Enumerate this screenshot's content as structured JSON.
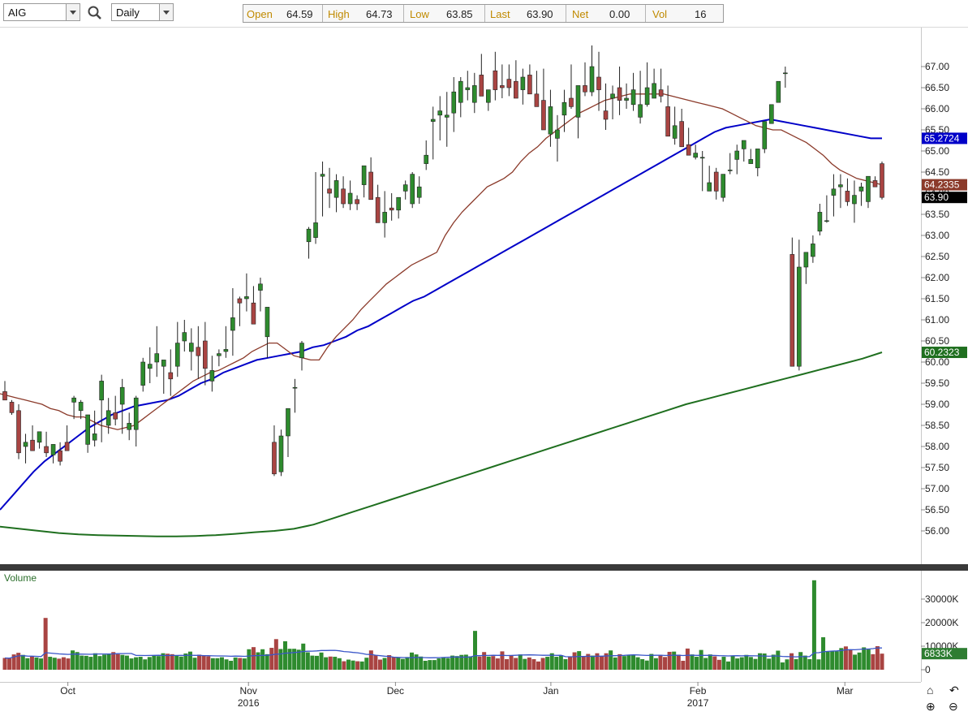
{
  "toolbar": {
    "symbol": "AIG",
    "period": "Daily",
    "open_label": "Open",
    "open": "64.59",
    "high_label": "High",
    "high": "64.73",
    "low_label": "Low",
    "low": "63.85",
    "last_label": "Last",
    "last": "63.90",
    "net_label": "Net",
    "net": "0.00",
    "vol_label": "Vol",
    "vol": "16"
  },
  "volume_panel": {
    "title": "Volume"
  },
  "colors": {
    "up": "#2e8b2e",
    "down": "#a94442",
    "ma20": "#8b3a2a",
    "ma50": "#0000c8",
    "ma200": "#1f6f1f",
    "last_tag": "#000000",
    "volume_ma": "#3a56c8"
  },
  "chart_data": [
    {
      "type": "candlestick",
      "panel": "price",
      "y_ticks": [
        "67.00",
        "66.50",
        "66.00",
        "65.50",
        "65.00",
        "64.50",
        "64.00",
        "63.50",
        "63.00",
        "62.50",
        "62.00",
        "61.50",
        "61.00",
        "60.50",
        "60.00",
        "59.50",
        "59.00",
        "58.50",
        "58.00",
        "57.50",
        "57.00",
        "56.50",
        "56.00"
      ],
      "ylim": [
        55.3,
        67.9
      ],
      "x_labels": [
        "Oct",
        "Nov",
        "Dec",
        "Jan",
        "Feb",
        "Mar"
      ],
      "x_sublabels": [
        "2016",
        "2017"
      ],
      "series": [
        {
          "name": "OHLC",
          "o": [
            59.3,
            59.05,
            58.85,
            58.0,
            58.15,
            58.1,
            58.0,
            57.8,
            57.9,
            58.1,
            59.05,
            58.85,
            58.05,
            58.15,
            59.1,
            58.5,
            58.8,
            59.0,
            58.4,
            58.4,
            59.45,
            59.85,
            60.0,
            59.9,
            59.75,
            59.9,
            60.5,
            60.25,
            60.35,
            60.5,
            59.55,
            60.15,
            60.25,
            60.75,
            61.5,
            61.5,
            61.4,
            61.7,
            60.6,
            58.1,
            57.4,
            58.25,
            59.4,
            60.1,
            62.85,
            62.95,
            64.4,
            64.1,
            63.9,
            64.1,
            63.75,
            63.85,
            64.2,
            64.5,
            63.9,
            63.3,
            63.65,
            63.6,
            64.05,
            63.75,
            63.9,
            64.7,
            65.7,
            65.85,
            65.8,
            65.9,
            66.15,
            66.45,
            66.15,
            66.8,
            66.15,
            66.9,
            66.55,
            66.7,
            66.65,
            66.45,
            66.8,
            66.35,
            66.2,
            65.4,
            65.3,
            65.85,
            66.25,
            65.8,
            66.55,
            66.4,
            66.75,
            65.95,
            66.25,
            66.5,
            66.2,
            66.1,
            65.8,
            66.1,
            66.25,
            66.45,
            66.05,
            65.3,
            65.7,
            65.15,
            64.85,
            64.85,
            64.05,
            64.5,
            63.9,
            64.55,
            64.8,
            65.05,
            64.7,
            64.6,
            65.05,
            65.65,
            66.15,
            66.85,
            62.55,
            59.9,
            62.25,
            62.5,
            63.1,
            63.35,
            63.95,
            64.15,
            64.05,
            63.75,
            64.05,
            63.8,
            64.3,
            64.7
          ],
          "h": [
            59.55,
            59.1,
            59.0,
            58.3,
            58.5,
            58.25,
            58.35,
            58.05,
            58.1,
            58.5,
            59.2,
            59.1,
            58.6,
            58.85,
            59.7,
            59.15,
            59.2,
            59.6,
            58.8,
            59.2,
            60.1,
            60.35,
            60.85,
            60.05,
            60.3,
            60.95,
            61.0,
            60.8,
            60.85,
            60.95,
            60.15,
            60.3,
            60.85,
            61.75,
            61.55,
            62.1,
            61.8,
            62.0,
            61.3,
            58.5,
            58.4,
            58.75,
            59.6,
            60.5,
            63.2,
            64.5,
            64.75,
            64.6,
            64.45,
            64.4,
            64.3,
            63.95,
            64.65,
            64.85,
            64.2,
            64.05,
            64.0,
            63.9,
            64.3,
            64.5,
            64.4,
            65.25,
            66.05,
            66.3,
            66.4,
            66.75,
            66.75,
            66.9,
            66.85,
            67.3,
            66.35,
            67.35,
            67.05,
            67.05,
            67.15,
            66.95,
            67.05,
            66.9,
            66.95,
            66.45,
            65.85,
            66.45,
            67.05,
            66.35,
            67.1,
            67.5,
            67.35,
            66.6,
            66.55,
            67.0,
            66.6,
            66.85,
            66.9,
            67.1,
            66.95,
            66.95,
            66.55,
            66.05,
            66.0,
            65.55,
            65.15,
            65.0,
            64.65,
            64.6,
            64.1,
            64.95,
            65.15,
            65.25,
            65.05,
            65.0,
            65.45,
            66.05,
            66.25,
            67.0,
            62.95,
            62.9,
            62.55,
            63.0,
            63.75,
            63.95,
            64.45,
            64.45,
            64.35,
            64.3,
            64.25,
            64.35,
            64.4,
            64.75
          ],
          "l": [
            59.1,
            58.75,
            57.7,
            57.6,
            57.9,
            57.95,
            57.75,
            57.6,
            57.55,
            57.9,
            58.65,
            58.65,
            57.85,
            58.0,
            58.1,
            58.3,
            58.5,
            58.3,
            58.15,
            58.0,
            59.3,
            59.5,
            59.65,
            59.25,
            59.2,
            59.65,
            60.25,
            59.8,
            59.6,
            59.45,
            59.3,
            59.9,
            60.1,
            60.15,
            60.85,
            61.2,
            61.0,
            61.2,
            60.1,
            57.3,
            57.3,
            57.75,
            58.8,
            59.8,
            62.45,
            62.8,
            63.45,
            63.65,
            63.55,
            63.65,
            63.6,
            63.6,
            63.9,
            63.85,
            63.5,
            62.95,
            63.35,
            63.4,
            63.85,
            63.65,
            63.75,
            64.55,
            64.8,
            65.25,
            65.1,
            65.45,
            65.8,
            66.2,
            65.9,
            66.45,
            65.95,
            66.2,
            66.25,
            66.3,
            66.35,
            66.1,
            66.5,
            66.15,
            66.0,
            65.1,
            64.75,
            65.45,
            66.0,
            65.3,
            66.3,
            66.3,
            65.95,
            65.5,
            65.75,
            65.85,
            66.0,
            65.95,
            65.65,
            66.05,
            66.25,
            66.15,
            65.35,
            65.15,
            65.15,
            64.9,
            64.8,
            64.05,
            64.05,
            63.85,
            63.8,
            64.45,
            64.45,
            64.75,
            64.7,
            64.4,
            64.95,
            65.65,
            66.15,
            66.5,
            60.4,
            59.8,
            61.85,
            62.35,
            63.0,
            63.3,
            63.45,
            63.65,
            63.7,
            63.3,
            63.7,
            63.65,
            64.2,
            63.85
          ],
          "c": [
            59.1,
            58.8,
            57.85,
            58.1,
            57.9,
            58.35,
            57.85,
            58.05,
            57.65,
            57.9,
            59.15,
            59.05,
            58.75,
            58.3,
            59.55,
            58.85,
            58.65,
            59.4,
            58.55,
            59.15,
            60.0,
            59.95,
            60.2,
            60.05,
            59.6,
            60.45,
            60.7,
            60.45,
            60.15,
            59.85,
            59.8,
            60.2,
            60.3,
            61.05,
            61.4,
            61.55,
            60.9,
            61.85,
            61.3,
            57.35,
            58.25,
            58.9,
            59.4,
            60.45,
            63.15,
            63.3,
            64.45,
            64.0,
            64.3,
            63.75,
            64.0,
            63.75,
            64.65,
            63.85,
            63.3,
            63.55,
            63.6,
            63.9,
            64.2,
            64.45,
            64.15,
            64.9,
            65.75,
            65.95,
            65.85,
            66.4,
            66.65,
            66.5,
            66.55,
            66.3,
            66.45,
            66.45,
            66.5,
            66.5,
            66.25,
            66.75,
            66.35,
            66.05,
            65.5,
            66.05,
            65.5,
            66.15,
            66.05,
            66.55,
            66.4,
            67.0,
            66.45,
            65.75,
            66.35,
            66.2,
            66.25,
            66.45,
            66.1,
            66.5,
            66.6,
            66.3,
            65.35,
            65.6,
            65.1,
            64.9,
            64.95,
            64.85,
            64.25,
            64.05,
            64.45,
            64.55,
            65.0,
            65.25,
            64.8,
            65.05,
            65.7,
            66.1,
            66.65,
            66.85,
            59.9,
            62.25,
            62.6,
            62.8,
            63.55,
            63.35,
            64.1,
            64.2,
            63.8,
            63.95,
            64.15,
            64.4,
            64.15,
            63.9
          ]
        },
        {
          "name": "MA20",
          "values": [
            59.25,
            59.2,
            59.15,
            59.1,
            59.05,
            59.0,
            58.9,
            58.85,
            58.75,
            58.7,
            58.7,
            58.6,
            58.5,
            58.45,
            58.4,
            58.45,
            58.5,
            58.65,
            58.8,
            58.95,
            59.1,
            59.25,
            59.4,
            59.55,
            59.65,
            59.75,
            59.8,
            59.9,
            60.0,
            60.1,
            60.25,
            60.35,
            60.45,
            60.45,
            60.3,
            60.15,
            60.1,
            60.05,
            60.05,
            60.35,
            60.6,
            60.8,
            61.0,
            61.25,
            61.45,
            61.65,
            61.85,
            62.0,
            62.15,
            62.3,
            62.4,
            62.5,
            62.6,
            63.0,
            63.3,
            63.55,
            63.75,
            63.95,
            64.15,
            64.25,
            64.35,
            64.5,
            64.75,
            64.95,
            65.1,
            65.3,
            65.45,
            65.6,
            65.75,
            65.9,
            66.0,
            66.1,
            66.2,
            66.25,
            66.3,
            66.35,
            66.35,
            66.35,
            66.35,
            66.35,
            66.3,
            66.25,
            66.2,
            66.15,
            66.1,
            66.05,
            66.0,
            65.9,
            65.8,
            65.7,
            65.6,
            65.55,
            65.5,
            65.5,
            65.4,
            65.3,
            65.2,
            65.05,
            64.9,
            64.7,
            64.55,
            64.45,
            64.35,
            64.3,
            64.25,
            64.2
          ]
        },
        {
          "name": "MA50",
          "values": [
            56.5,
            56.8,
            57.1,
            57.4,
            57.65,
            57.85,
            58.05,
            58.25,
            58.45,
            58.6,
            58.75,
            58.85,
            58.95,
            59.0,
            59.05,
            59.1,
            59.2,
            59.35,
            59.5,
            59.6,
            59.75,
            59.85,
            59.95,
            60.05,
            60.1,
            60.15,
            60.2,
            60.25,
            60.35,
            60.4,
            60.5,
            60.6,
            60.75,
            60.85,
            61.0,
            61.15,
            61.3,
            61.45,
            61.55,
            61.7,
            61.85,
            62.0,
            62.15,
            62.3,
            62.45,
            62.6,
            62.75,
            62.9,
            63.05,
            63.2,
            63.35,
            63.5,
            63.65,
            63.8,
            63.95,
            64.1,
            64.25,
            64.4,
            64.55,
            64.7,
            64.85,
            65.0,
            65.15,
            65.3,
            65.45,
            65.55,
            65.6,
            65.65,
            65.7,
            65.75,
            65.7,
            65.65,
            65.6,
            65.55,
            65.5,
            65.45,
            65.4,
            65.35,
            65.3,
            65.3
          ]
        },
        {
          "name": "MA200",
          "values": [
            56.1,
            56.05,
            56.0,
            55.95,
            55.92,
            55.9,
            55.89,
            55.88,
            55.87,
            55.87,
            55.88,
            55.9,
            55.93,
            55.97,
            56.0,
            56.05,
            56.15,
            56.3,
            56.45,
            56.6,
            56.75,
            56.9,
            57.05,
            57.2,
            57.35,
            57.5,
            57.65,
            57.8,
            57.95,
            58.1,
            58.25,
            58.4,
            58.55,
            58.7,
            58.85,
            59.0,
            59.12,
            59.24,
            59.36,
            59.48,
            59.6,
            59.72,
            59.84,
            59.96,
            60.08,
            60.23
          ]
        }
      ],
      "value_tags": [
        {
          "label": "65.2724",
          "series": "MA50"
        },
        {
          "label": "64.2335",
          "series": "MA20"
        },
        {
          "label": "63.90",
          "series": "Last"
        },
        {
          "label": "60.2323",
          "series": "MA200"
        }
      ],
      "grid": false
    },
    {
      "type": "bar",
      "panel": "volume",
      "title": "Volume",
      "y_ticks": [
        "30000K",
        "20000K",
        "10000K",
        "0"
      ],
      "ylim": [
        0,
        40000
      ],
      "current_label": "6833K",
      "values": [
        5000,
        4800,
        6500,
        7200,
        6300,
        4900,
        5600,
        5200,
        4800,
        22000,
        5500,
        5100,
        4700,
        5300,
        4800,
        8200,
        7500,
        6000,
        5900,
        5500,
        7000,
        5800,
        6400,
        6900,
        7500,
        6600,
        6300,
        6000,
        4800,
        5300,
        5500,
        4400,
        5400,
        6100,
        5800,
        7000,
        6800,
        6600,
        6000,
        5600,
        6900,
        7700,
        5100,
        6400,
        6000,
        5700,
        4900,
        4900,
        5300,
        4400,
        3800,
        5200,
        5000,
        4800,
        8700,
        9600,
        7400,
        8700,
        6600,
        9300,
        13000,
        8800,
        12100,
        8900,
        8900,
        8500,
        11100,
        7400,
        6000,
        5900,
        7300,
        5300,
        5600,
        5500,
        4900,
        3600,
        4300,
        3900,
        3600,
        3500,
        5100,
        8200,
        6100,
        4300,
        5000,
        6200,
        5400,
        5200,
        4600,
        5400,
        7300,
        6500,
        5600,
        3800,
        4100,
        4100,
        4800,
        5200,
        4900,
        6000,
        5800,
        6300,
        6400,
        5700,
        16500,
        5600,
        7500,
        5600,
        5800,
        4800,
        7800,
        4500,
        6200,
        5000,
        6500,
        4600,
        5200,
        4500,
        3500,
        5000,
        5500,
        7000,
        5500,
        6200,
        4500,
        5400,
        7400,
        7900,
        5700,
        6700,
        6000,
        7000,
        5800,
        7000,
        8200,
        5200,
        6600,
        5800,
        6300,
        6300,
        5300,
        4500,
        3900,
        6700,
        4900,
        6300,
        5400,
        7600,
        7700,
        6400,
        3800,
        9000,
        6500,
        5500,
        8400,
        5000,
        6500,
        5700,
        4200,
        5500,
        3500,
        6000,
        4800,
        5300,
        6300,
        5400,
        4600,
        7000,
        6900,
        4700,
        6400,
        8100,
        3100,
        4400,
        7000,
        4500,
        7500,
        6000,
        4500,
        38000,
        4400,
        13800,
        7700,
        8000,
        7800,
        9200,
        9900,
        8500,
        6400,
        7300,
        9500,
        8600,
        6600,
        10000,
        6833
      ]
    }
  ]
}
